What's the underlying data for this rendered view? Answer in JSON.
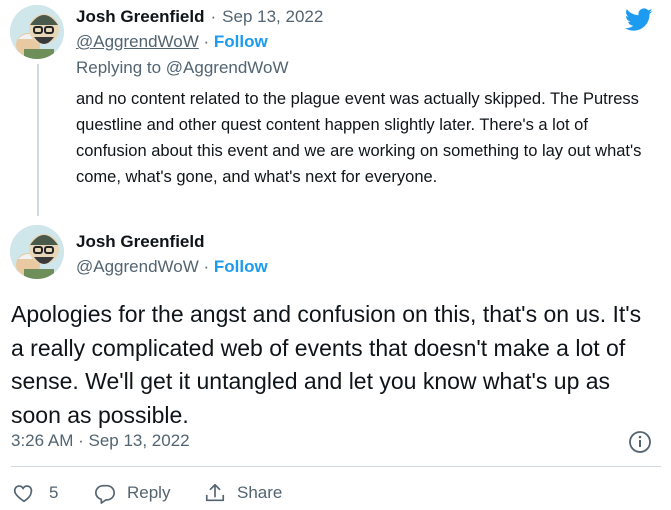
{
  "reply_tweet": {
    "author_name": "Josh Greenfield",
    "date": "Sep 13, 2022",
    "handle": "@AggrendWoW",
    "follow_label": "Follow",
    "replying_to": "Replying to @AggrendWoW",
    "text": "and no content related to the plague event was actually skipped. The Putress questline and other quest content happen slightly later. There's a lot of confusion about this event and we are working on something to lay out what's come, what's gone, and what's next for everyone."
  },
  "main_tweet": {
    "author_name": "Josh Greenfield",
    "handle": "@AggrendWoW",
    "follow_label": "Follow",
    "text": "Apologies for the angst and confusion on this, that's on us. It's a really complicated web of events that doesn't make a lot of sense. We'll get it untangled and let you know what's up as soon as possible.",
    "timestamp": "3:26 AM · Sep 13, 2022"
  },
  "actions": {
    "like_count": "5",
    "reply_label": "Reply",
    "share_label": "Share"
  },
  "icons": {
    "logo": "twitter-bird-icon",
    "info": "info-icon",
    "like": "heart-icon",
    "reply": "reply-bubble-icon",
    "share": "share-upload-icon"
  },
  "colors": {
    "brand": "#1d9bf0",
    "text": "#0f1419",
    "muted": "#536471",
    "divider": "#cfd9de"
  }
}
